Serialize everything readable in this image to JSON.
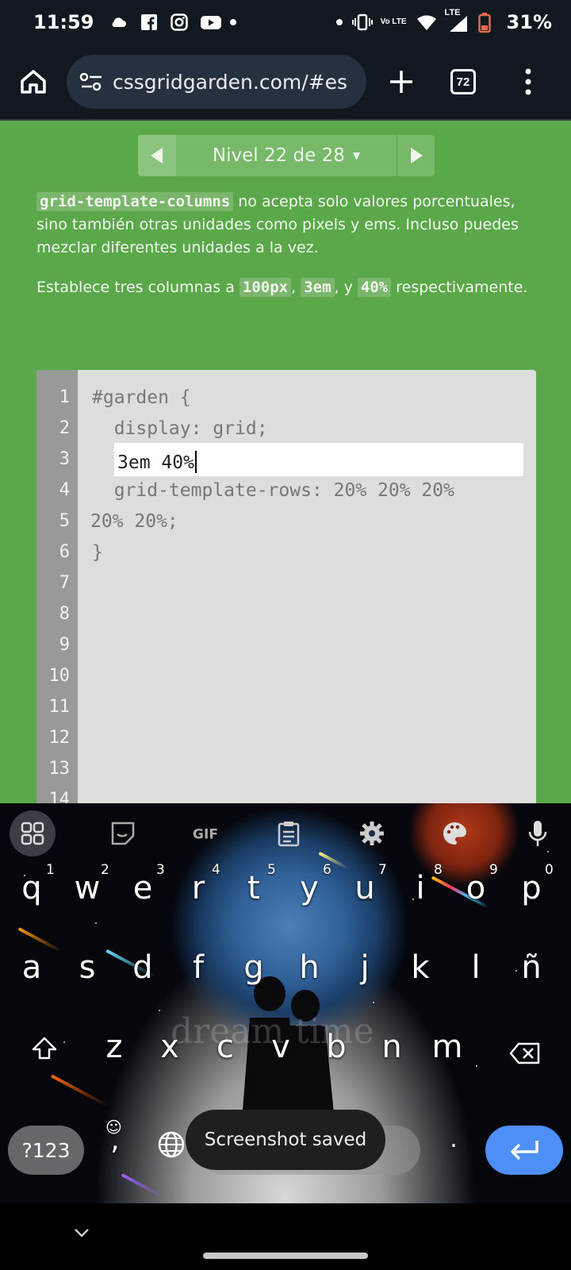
{
  "status_bar": {
    "time": "11:59",
    "battery": "31%",
    "network": "LTE",
    "volte": "Vo LTE"
  },
  "browser": {
    "url": "cssgridgarden.com/#es",
    "tab_count": "72"
  },
  "level_nav": {
    "title": "Nivel 22 de 28"
  },
  "instructions": {
    "p1_code": "grid-template-columns",
    "p1_text": " no acepta solo valores porcentuales, sino también otras unidades como pixels y ems. Incluso puedes mezclar diferentes unidades a la vez.",
    "p2_prefix": "Establece tres columnas a ",
    "p2_code1": "100px",
    "p2_sep1": ", ",
    "p2_code2": "3em",
    "p2_sep2": ", y ",
    "p2_code3": "40%",
    "p2_suffix": " respectivamente."
  },
  "editor": {
    "line_numbers": [
      "1",
      "2",
      "3",
      "4",
      "5",
      "6",
      "7",
      "8",
      "9",
      "10",
      "11",
      "12",
      "13",
      "14"
    ],
    "line1": "#garden {",
    "line2": "  display: grid;",
    "input_value": "3em 40%",
    "line4": "  grid-template-rows: 20% 20% 20%",
    "line5": "20% 20%;",
    "line6": "}"
  },
  "keyboard": {
    "row1": [
      "q",
      "w",
      "e",
      "r",
      "t",
      "y",
      "u",
      "i",
      "o",
      "p"
    ],
    "row1_hints": [
      "1",
      "2",
      "3",
      "4",
      "5",
      "6",
      "7",
      "8",
      "9",
      "0"
    ],
    "row2": [
      "a",
      "s",
      "d",
      "f",
      "g",
      "h",
      "j",
      "k",
      "l",
      "ñ"
    ],
    "row3": [
      "z",
      "x",
      "c",
      "v",
      "b",
      "n",
      "m"
    ],
    "symbols_label": "?123",
    "comma": ",",
    "period": ".",
    "watermark": "dream time"
  },
  "toast": "Screenshot saved",
  "colors": {
    "page_green": "#5aa84a",
    "enter_blue": "#4e8ef7"
  }
}
